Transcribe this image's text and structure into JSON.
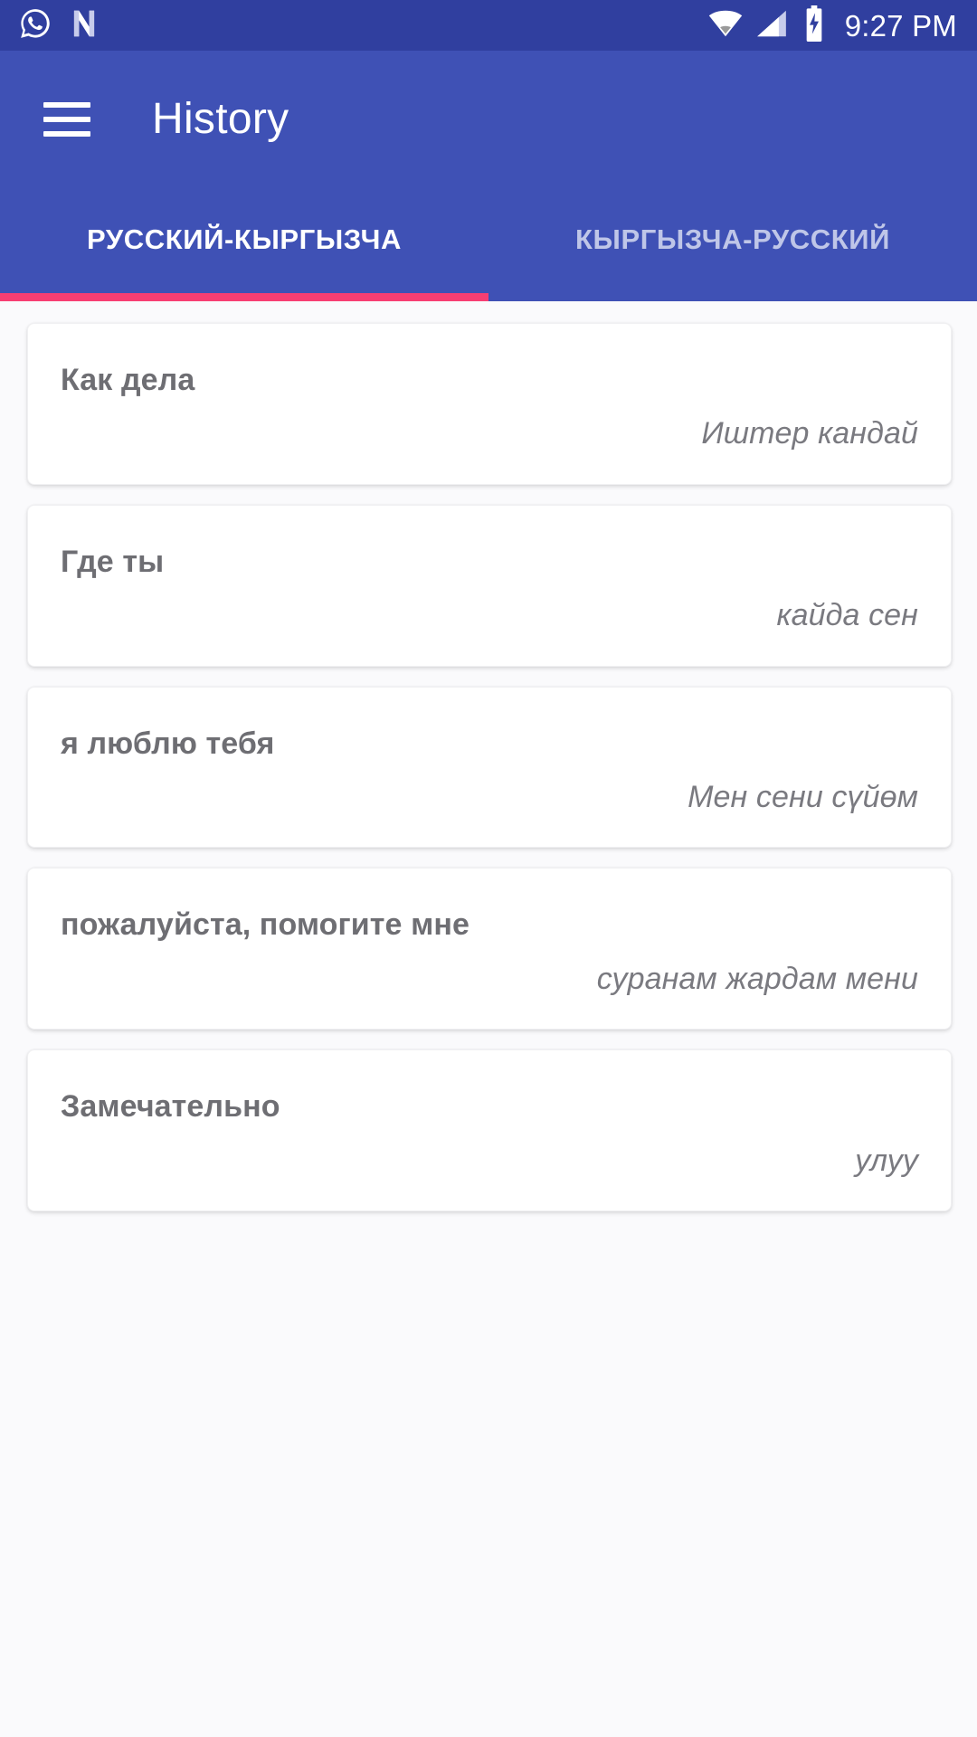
{
  "status_bar": {
    "icons_left": [
      "whatsapp-icon",
      "n-logo-icon"
    ],
    "icons_right": [
      "wifi-icon",
      "cellular-signal-icon",
      "battery-charging-icon"
    ],
    "clock": "9:27 PM",
    "background_color": "#303F9F"
  },
  "toolbar": {
    "menu_icon": "hamburger-menu-icon",
    "title": "History",
    "background_color": "#3F51B5"
  },
  "tabs": {
    "indicator_color": "#F73E72",
    "selected_index": 0,
    "items": [
      {
        "label": "РУССКИЙ-КЫРГЫЗЧА",
        "active": true
      },
      {
        "label": "КЫРГЫЗЧА-РУССКИЙ",
        "active": false
      }
    ]
  },
  "history": {
    "background_color": "#FAFAFC",
    "items": [
      {
        "source": "Как дела",
        "target": "Иштер кандай"
      },
      {
        "source": "Где ты",
        "target": "кайда сен"
      },
      {
        "source": "я люблю тебя",
        "target": "Мен сени сүйөм"
      },
      {
        "source": "пожалуйста, помогите мне",
        "target": "суранам жардам мени"
      },
      {
        "source": "Замечательно",
        "target": "улуу"
      }
    ]
  }
}
